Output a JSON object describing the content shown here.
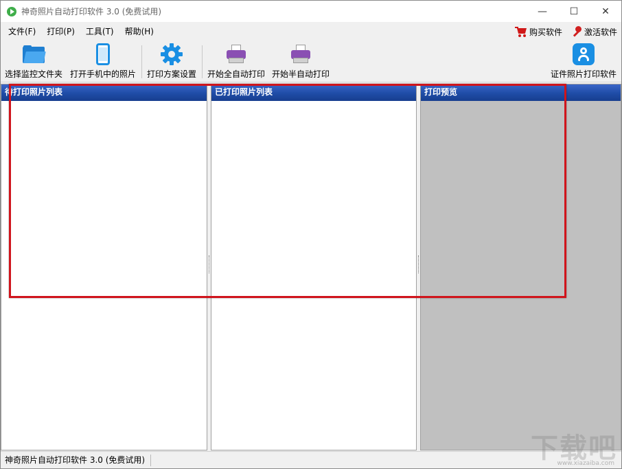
{
  "window": {
    "title": "神奇照片自动打印软件 3.0 (免费试用)",
    "controls": {
      "minimize": "—",
      "maximize": "☐",
      "close": "✕"
    }
  },
  "menubar": {
    "items": [
      {
        "label": "文件(F)"
      },
      {
        "label": "打印(P)"
      },
      {
        "label": "工具(T)"
      },
      {
        "label": "帮助(H)"
      }
    ],
    "right": {
      "buy_label": "购买软件",
      "activate_label": "激活软件"
    }
  },
  "toolbar": {
    "buttons": [
      {
        "label": "选择监控文件夹",
        "icon": "folder-icon"
      },
      {
        "label": "打开手机中的照片",
        "icon": "phone-icon"
      },
      {
        "label": "打印方案设置",
        "icon": "gear-icon"
      },
      {
        "label": "开始全自动打印",
        "icon": "printer-icon"
      },
      {
        "label": "开始半自动打印",
        "icon": "printer-icon"
      },
      {
        "label": "证件照片打印软件",
        "icon": "id-photo-icon"
      }
    ]
  },
  "panels": {
    "pending": {
      "header": "待打印照片列表"
    },
    "printed": {
      "header": "已打印照片列表"
    },
    "preview": {
      "header": "打印预览"
    }
  },
  "statusbar": {
    "text": "神奇照片自动打印软件 3.0 (免费试用)"
  },
  "watermark": {
    "text": "下载吧",
    "url": "www.xiazaiba.com"
  },
  "colors": {
    "panel_header": "#1f4ca6",
    "preview_bg": "#c0c0c0",
    "highlight": "#d0141c",
    "icon_blue": "#1a8fe3",
    "printer_purple": "#8a4fb3",
    "cart_red": "#d01818"
  }
}
